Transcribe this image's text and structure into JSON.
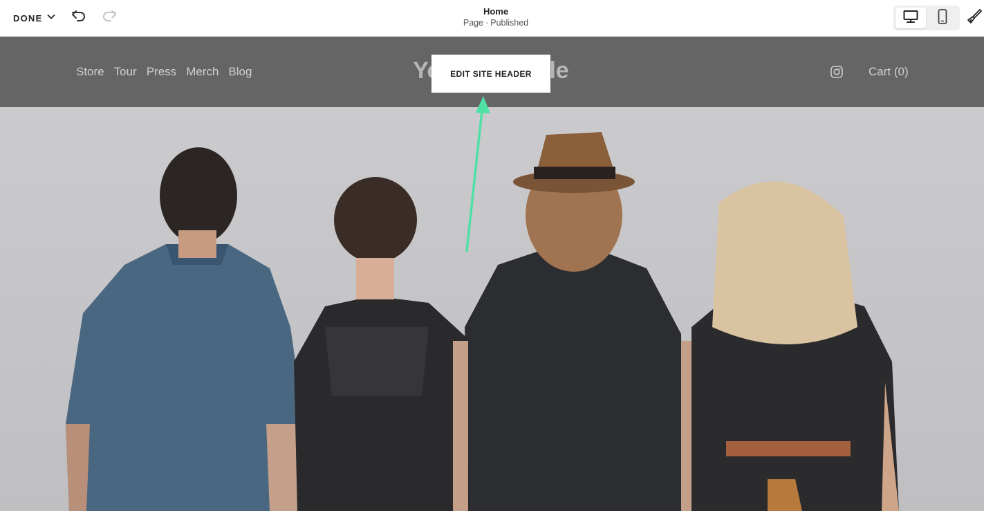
{
  "toolbar": {
    "done_label": "DONE",
    "page_title": "Home",
    "page_type": "Page",
    "page_status": "Published"
  },
  "site": {
    "nav": [
      "Store",
      "Tour",
      "Press",
      "Merch",
      "Blog"
    ],
    "site_title": "Your Site Title",
    "cart_label": "Cart (0)",
    "edit_header_label": "EDIT SITE HEADER"
  },
  "icons": {
    "done_dropdown": "chevron-down-icon",
    "undo": "undo-icon",
    "redo": "redo-icon",
    "desktop_view": "desktop-icon",
    "mobile_view": "mobile-icon",
    "site_styles": "paintbrush-icon",
    "social": "instagram-icon"
  },
  "colors": {
    "header_overlay": "#5c5c5e",
    "annotation_arrow": "#4fe0a5",
    "hero_background": "#c8c8cb"
  }
}
